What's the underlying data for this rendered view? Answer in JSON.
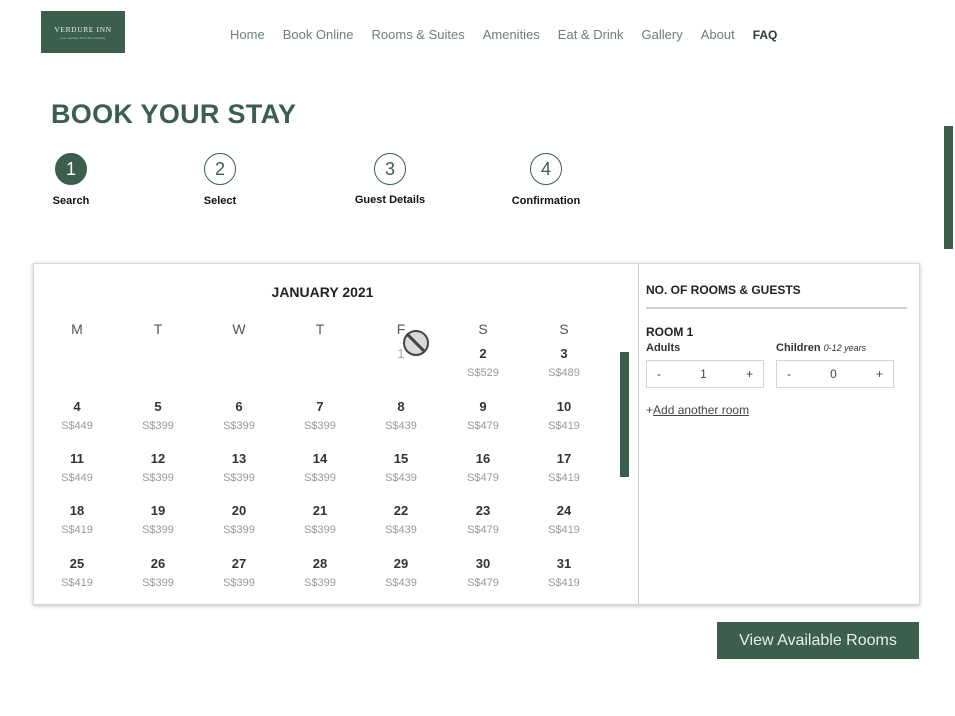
{
  "logo": {
    "name": "VERDURE INN",
    "tagline": "your escape from the ordinary"
  },
  "nav": [
    "Home",
    "Book Online",
    "Rooms & Suites",
    "Amenities",
    "Eat & Drink",
    "Gallery",
    "About",
    "FAQ"
  ],
  "nav_active": "FAQ",
  "page_title": "BOOK YOUR STAY",
  "steps": [
    {
      "number": "1",
      "label": "Search",
      "active": true
    },
    {
      "number": "2",
      "label": "Select",
      "active": false
    },
    {
      "number": "3",
      "label": "Guest Details",
      "active": false
    },
    {
      "number": "4",
      "label": "Confirmation",
      "active": false
    }
  ],
  "calendar": {
    "month_title": "JANUARY 2021",
    "weekdays": [
      "M",
      "T",
      "W",
      "T",
      "F",
      "S",
      "S"
    ],
    "days": [
      {
        "day": "1",
        "price": "",
        "unavailable": true
      },
      {
        "day": "2",
        "price": "S$529"
      },
      {
        "day": "3",
        "price": "S$489"
      },
      {
        "day": "4",
        "price": "S$449"
      },
      {
        "day": "5",
        "price": "S$399"
      },
      {
        "day": "6",
        "price": "S$399"
      },
      {
        "day": "7",
        "price": "S$399"
      },
      {
        "day": "8",
        "price": "S$439"
      },
      {
        "day": "9",
        "price": "S$479"
      },
      {
        "day": "10",
        "price": "S$419"
      },
      {
        "day": "11",
        "price": "S$449"
      },
      {
        "day": "12",
        "price": "S$399"
      },
      {
        "day": "13",
        "price": "S$399"
      },
      {
        "day": "14",
        "price": "S$399"
      },
      {
        "day": "15",
        "price": "S$439"
      },
      {
        "day": "16",
        "price": "S$479"
      },
      {
        "day": "17",
        "price": "S$419"
      },
      {
        "day": "18",
        "price": "S$419"
      },
      {
        "day": "19",
        "price": "S$399"
      },
      {
        "day": "20",
        "price": "S$399"
      },
      {
        "day": "21",
        "price": "S$399"
      },
      {
        "day": "22",
        "price": "S$439"
      },
      {
        "day": "23",
        "price": "S$479"
      },
      {
        "day": "24",
        "price": "S$419"
      },
      {
        "day": "25",
        "price": "S$419"
      },
      {
        "day": "26",
        "price": "S$399"
      },
      {
        "day": "27",
        "price": "S$399"
      },
      {
        "day": "28",
        "price": "S$399"
      },
      {
        "day": "29",
        "price": "S$439"
      },
      {
        "day": "30",
        "price": "S$479"
      },
      {
        "day": "31",
        "price": "S$419"
      }
    ]
  },
  "guests": {
    "heading": "NO. OF ROOMS & GUESTS",
    "room_label": "ROOM 1",
    "adults_label": "Adults",
    "children_label": "Children",
    "children_note": "0-12 years",
    "adults_value": "1",
    "children_value": "0",
    "minus": "-",
    "plus": "+",
    "add_room_prefix": "+",
    "add_room_link": "Add another room"
  },
  "cta": "View Available Rooms",
  "colors": {
    "brand_green": "#3b5e4d",
    "nav_text": "#6f7f76"
  },
  "icons": {
    "unavailable_cursor": "no-entry-icon"
  }
}
